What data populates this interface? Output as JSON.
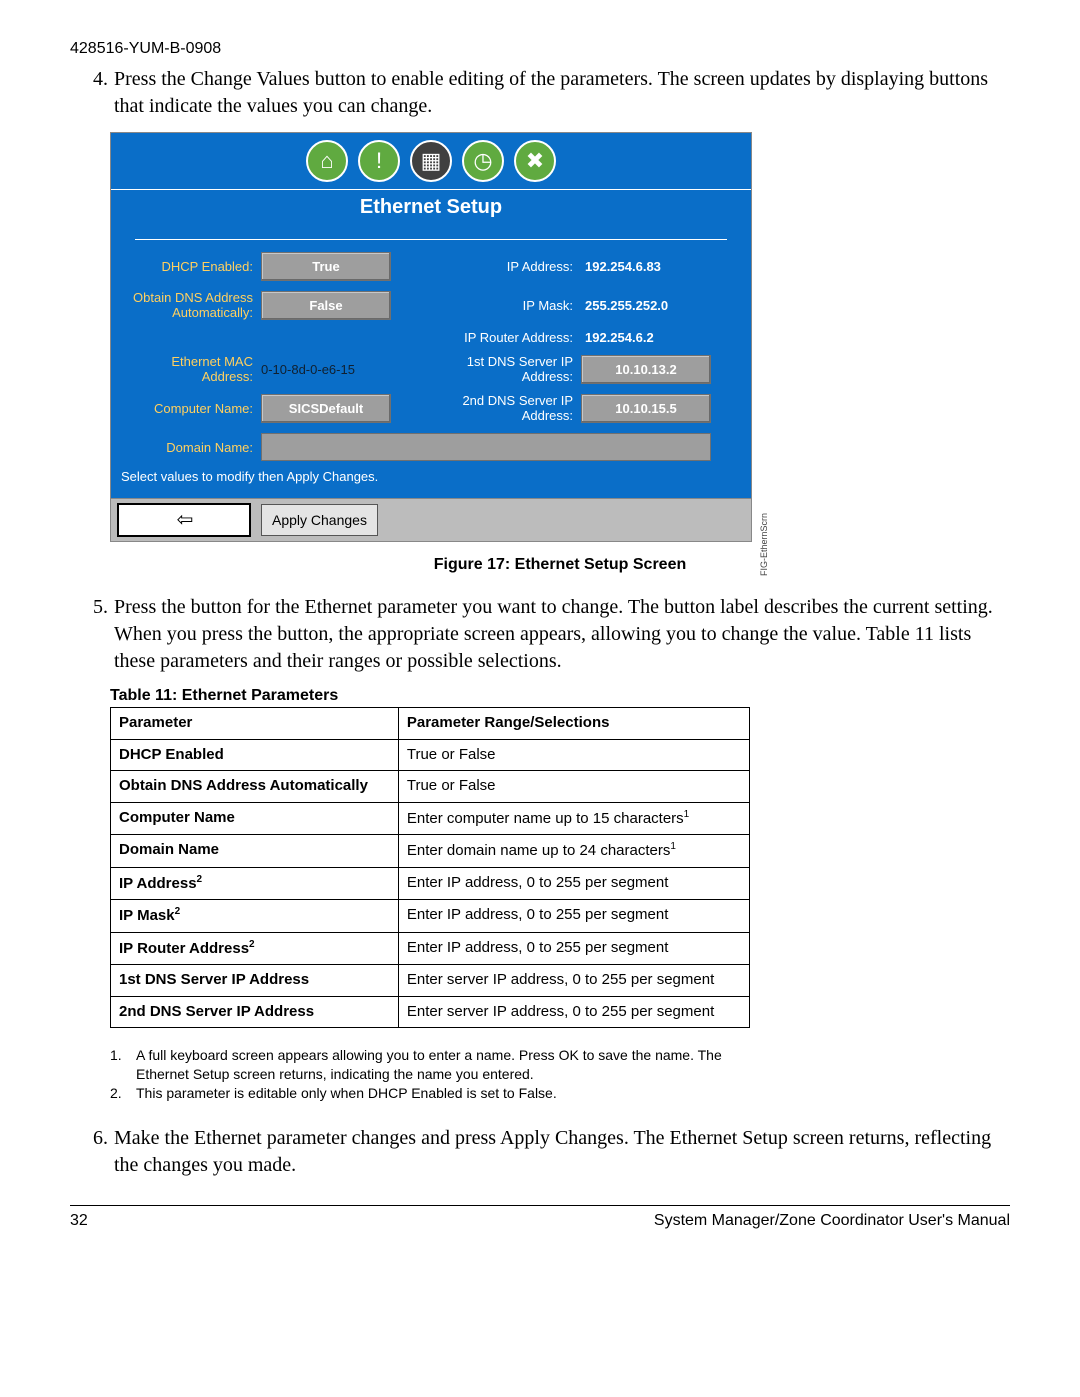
{
  "doc_id": "428516-YUM-B-0908",
  "step4": {
    "num": "4.",
    "text": "Press the Change Values button to enable editing of the parameters. The screen updates by displaying buttons that indicate the values you can change."
  },
  "screen": {
    "title": "Ethernet Setup",
    "left": {
      "dhcp_label": "DHCP Enabled:",
      "dhcp_val": "True",
      "dns_auto_label": "Obtain DNS Address Automatically:",
      "dns_auto_val": "False",
      "mac_label": "Ethernet MAC Address:",
      "mac_val": "0-10-8d-0-e6-15",
      "cname_label": "Computer Name:",
      "cname_val": "SICSDefault",
      "dname_label": "Domain Name:"
    },
    "right": {
      "ip_label": "IP Address:",
      "ip_val": "192.254.6.83",
      "mask_label": "IP Mask:",
      "mask_val": "255.255.252.0",
      "router_label": "IP Router Address:",
      "router_val": "192.254.6.2",
      "dns1_label": "1st DNS Server IP Address:",
      "dns1_val": "10.10.13.2",
      "dns2_label": "2nd DNS Server IP Address:",
      "dns2_val": "10.10.15.5"
    },
    "instruction": "Select values to modify then Apply Changes.",
    "apply_label": "Apply Changes",
    "side_label": "FIG-EthernScrn"
  },
  "figure_caption": "Figure 17: Ethernet Setup Screen",
  "step5": {
    "num": "5.",
    "text": "Press the button for the Ethernet parameter you want to change. The button label describes the current setting. When you press the button, the appropriate screen appears, allowing you to change the value. Table 11 lists these parameters and their ranges or possible selections."
  },
  "table_caption": "Table 11: Ethernet Parameters",
  "table_headers": {
    "col1": "Parameter",
    "col2": "Parameter Range/Selections"
  },
  "table_rows": [
    {
      "p": "DHCP Enabled",
      "r": "True or False",
      "sup_p": ""
    },
    {
      "p": "Obtain DNS Address Automatically",
      "r": "True or False",
      "sup_p": ""
    },
    {
      "p": "Computer Name",
      "r": "Enter computer name up to 15 characters",
      "sup_p": "",
      "sup_r": "1"
    },
    {
      "p": "Domain Name",
      "r": "Enter domain name up to 24 characters",
      "sup_p": "",
      "sup_r": "1"
    },
    {
      "p": "IP Address",
      "r": "Enter IP address, 0 to 255 per segment",
      "sup_p": "2"
    },
    {
      "p": "IP Mask",
      "r": "Enter IP address, 0 to 255 per segment",
      "sup_p": "2"
    },
    {
      "p": "IP Router Address",
      "r": "Enter IP address, 0 to 255 per segment",
      "sup_p": "2"
    },
    {
      "p": "1st DNS Server IP Address",
      "r": "Enter server IP address, 0 to 255 per segment",
      "sup_p": ""
    },
    {
      "p": "2nd DNS Server IP Address",
      "r": "Enter server IP address, 0 to 255 per segment",
      "sup_p": ""
    }
  ],
  "footnotes": [
    {
      "n": "1.",
      "t": "A full keyboard screen appears allowing you to enter a name. Press OK to save the name. The Ethernet Setup screen returns, indicating the name you entered."
    },
    {
      "n": "2.",
      "t": "This parameter is editable only when DHCP Enabled is set to False."
    }
  ],
  "step6": {
    "num": "6.",
    "text": "Make the Ethernet parameter changes and press Apply Changes. The Ethernet Setup screen returns, reflecting the changes you made."
  },
  "footer": {
    "page": "32",
    "title": "System Manager/Zone Coordinator User's Manual"
  }
}
